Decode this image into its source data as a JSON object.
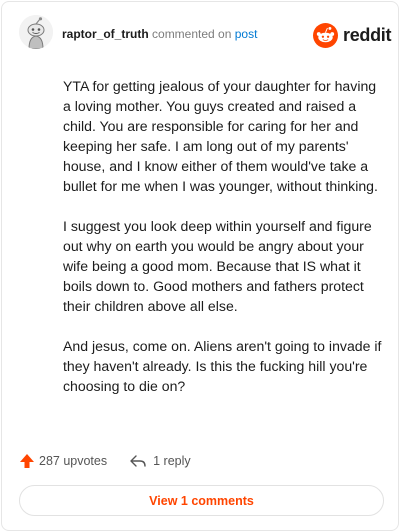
{
  "header": {
    "username": "raptor_of_truth",
    "action_text": "commented on",
    "post_link": "post",
    "brand": "reddit"
  },
  "comment": {
    "paragraphs": [
      "YTA for getting jealous of your daughter for having a loving mother. You guys created and raised a child. You are responsible for caring for her and keeping her safe. I am long out of my parents' house, and I know either of them would've take a bullet for me when I was younger, without thinking.",
      "I suggest you look deep within yourself and figure out why on earth you would be angry about your wife being a good mom. Because that IS what it boils down to. Good mothers and fathers protect their children above all else.",
      "And jesus, come on. Aliens aren't going to invade if they haven't already. Is this the fucking hill you're choosing to die on?"
    ]
  },
  "footer": {
    "upvotes": "287 upvotes",
    "replies": "1 reply",
    "view_comments": "View 1 comments"
  },
  "colors": {
    "brand": "#ff4500",
    "link": "#0079d3",
    "muted": "#7c7c7c"
  }
}
